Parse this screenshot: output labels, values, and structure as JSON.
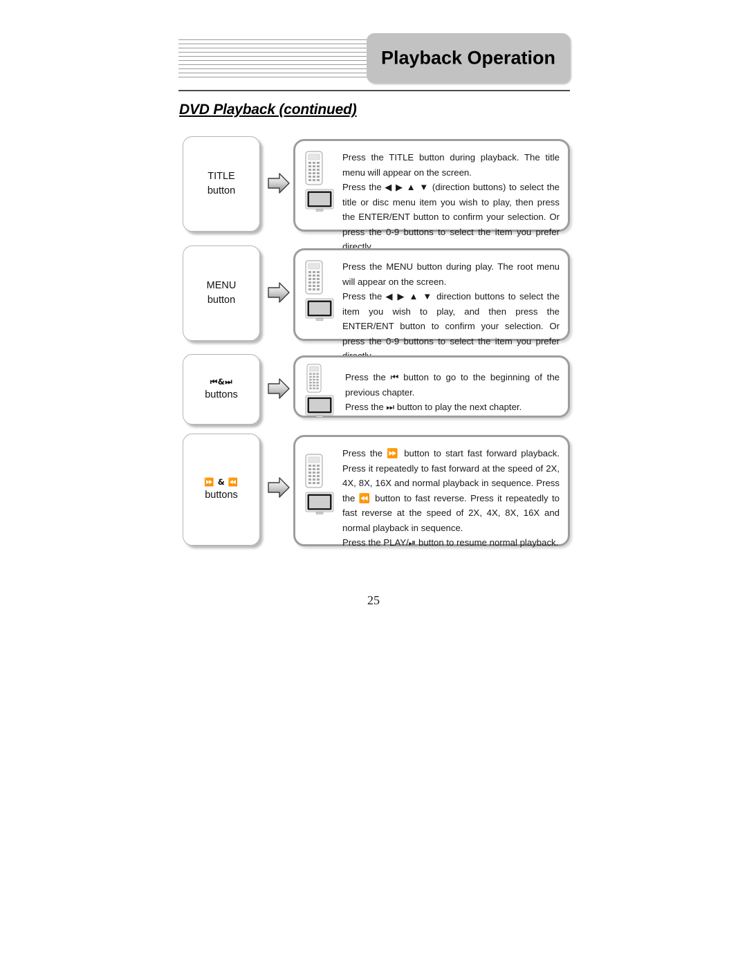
{
  "header": {
    "title": "Playback Operation",
    "stripes_icon": "horizontal-lines-decoration"
  },
  "section": {
    "heading": "DVD Playback (continued)"
  },
  "rows": [
    {
      "label_symbol": "",
      "label_line1": "TITLE",
      "label_line2": "button",
      "arrow_icon": "right-arrow-icon",
      "remote_icon": "remote-control-icon",
      "tv_icon": "tv-screen-icon",
      "paragraphs": [
        "Press the TITLE button during playback. The title menu will appear on the screen.",
        "Press the ◀ ▶ ▲ ▼ (direction buttons) to select the title or disc menu item you wish to play, then press the ENTER/ENT button to confirm your selection. Or press the 0-9 buttons to select the item you prefer directly."
      ]
    },
    {
      "label_symbol": "",
      "label_line1": "MENU",
      "label_line2": "button",
      "arrow_icon": "right-arrow-icon",
      "remote_icon": "remote-control-icon",
      "tv_icon": "tv-screen-icon",
      "paragraphs": [
        "Press the MENU button during play. The root menu will appear on the screen.",
        "Press the ◀ ▶ ▲ ▼ direction buttons to select the item you wish to play, and then press the ENTER/ENT button to confirm your selection. Or press the 0-9 buttons to select the item you prefer directly."
      ]
    },
    {
      "label_symbol": "⏮&⏭",
      "label_line1": "",
      "label_line2": "buttons",
      "arrow_icon": "right-arrow-icon",
      "remote_icon": "remote-control-icon",
      "tv_icon": "tv-screen-icon",
      "paragraphs": [
        "Press the ⏮ button to go to the beginning of the previous chapter.",
        "Press the ⏭ button to play the next chapter."
      ]
    },
    {
      "label_symbol": "⏩ & ⏪",
      "label_line1": "",
      "label_line2": "buttons",
      "arrow_icon": "right-arrow-icon",
      "remote_icon": "remote-control-icon",
      "tv_icon": "tv-screen-icon",
      "paragraphs": [
        "Press the ⏩ button to start fast forward playback. Press it repeatedly to fast forward at the speed of 2X, 4X, 8X, 16X and normal playback in sequence. Press the ⏪ button to fast reverse. Press it repeatedly to fast reverse at the speed of 2X, 4X, 8X, 16X and normal playback in sequence.",
        "Press the PLAY/⏯ button to resume normal playback."
      ]
    }
  ],
  "footer": {
    "page_number": "25"
  }
}
